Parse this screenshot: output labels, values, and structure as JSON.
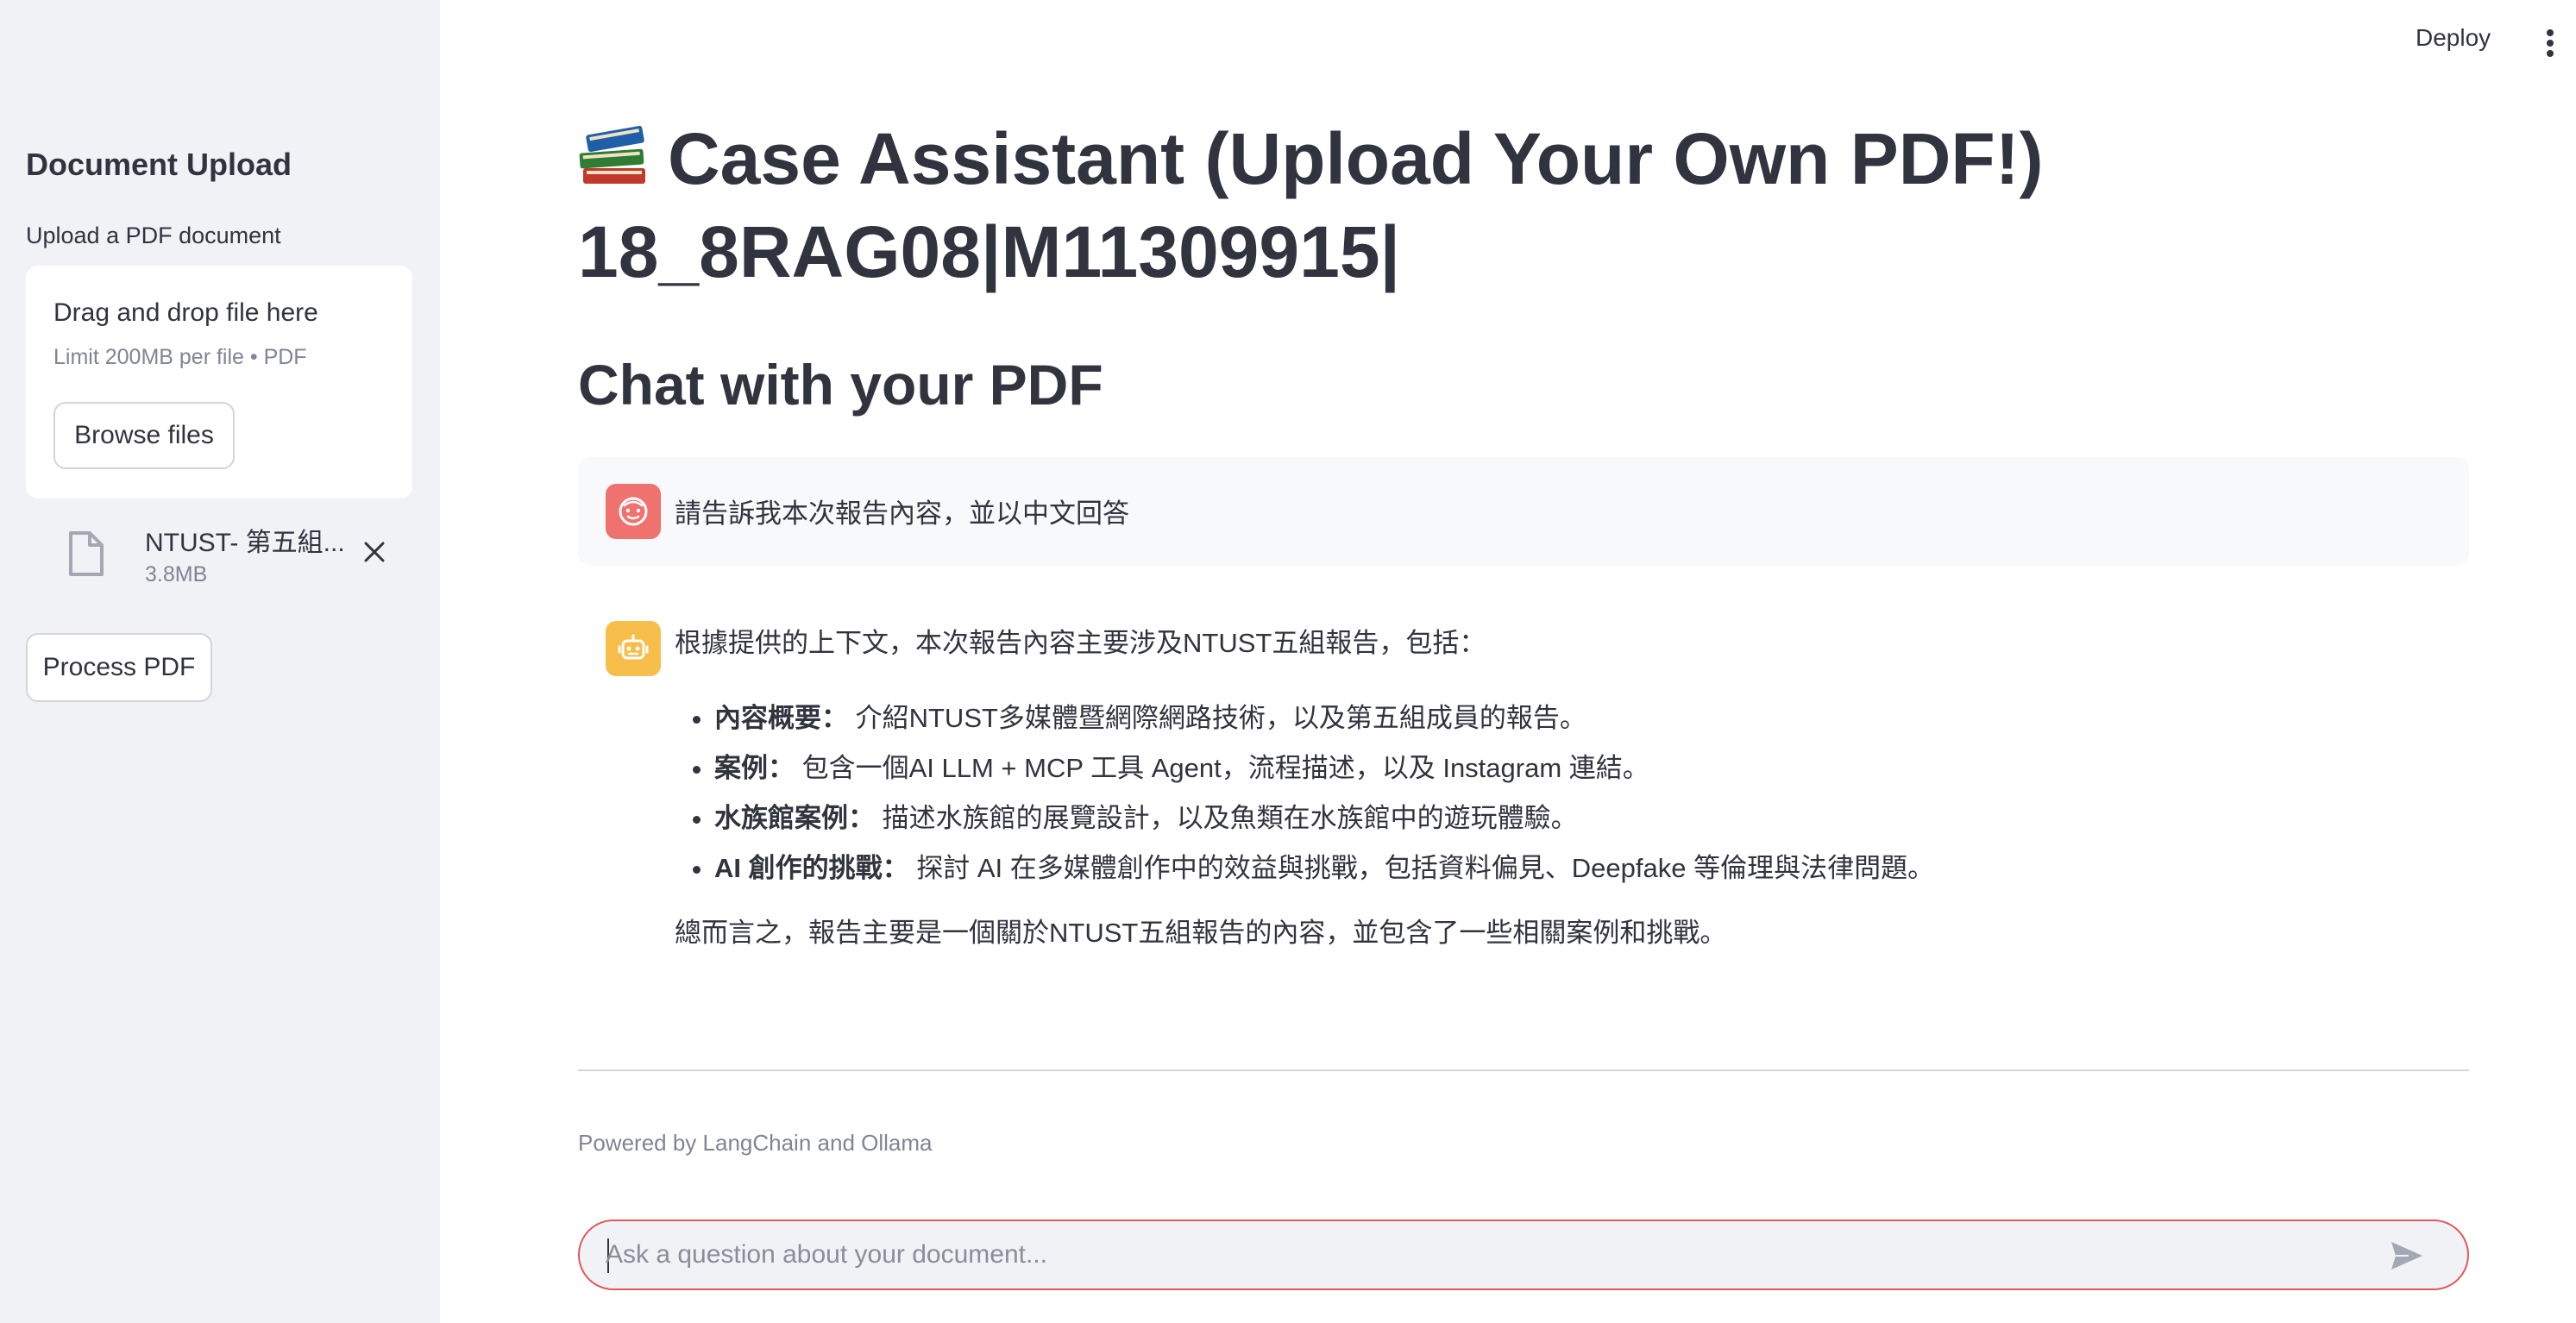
{
  "topbar": {
    "deploy_label": "Deploy",
    "menu_icon": "kebab-menu-icon"
  },
  "sidebar": {
    "title": "Document Upload",
    "upload_label": "Upload a PDF document",
    "dropzone": {
      "title": "Drag and drop file here",
      "limit": "Limit 200MB per file • PDF",
      "browse_label": "Browse files"
    },
    "file": {
      "name": "NTUST- 第五組...",
      "size": "3.8MB",
      "icon": "file-icon",
      "remove_icon": "close-icon"
    },
    "process_label": "Process PDF"
  },
  "main": {
    "title_icon": "books-icon",
    "title_line1": "Case Assistant (Upload Your Own PDF!)",
    "title_line2": "18_8RAG08|M11309915|",
    "subheader": "Chat with your PDF"
  },
  "chat": {
    "user_message": "請告訴我本次報告內容，並以中文回答",
    "bot_intro": "根據提供的上下文，本次報告內容主要涉及NTUST五組報告，包括：",
    "bot_items": [
      {
        "label": "內容概要：",
        "text": " 介紹NTUST多媒體暨網際網路技術，以及第五組成員的報告。"
      },
      {
        "label": "案例：",
        "text": " 包含一個AI LLM + MCP 工具 Agent，流程描述，以及 Instagram 連結。"
      },
      {
        "label": "水族館案例：",
        "text": " 描述水族館的展覽設計，以及魚類在水族館中的遊玩體驗。"
      },
      {
        "label": "AI 創作的挑戰：",
        "text": " 探討 AI 在多媒體創作中的效益與挑戰，包括資料偏見、Deepfake 等倫理與法律問題。"
      }
    ],
    "bot_summary": "總而言之，報告主要是一個關於NTUST五組報告的內容，並包含了一些相關案例和挑戰。"
  },
  "footer": {
    "note": "Powered by LangChain and Ollama"
  },
  "input": {
    "placeholder": "Ask a question about your document...",
    "value": ""
  },
  "colors": {
    "accent": "#ff4b4b",
    "user_avatar": "#f0726e",
    "bot_avatar": "#f8be4c",
    "sidebar_bg": "#f0f2f6"
  }
}
